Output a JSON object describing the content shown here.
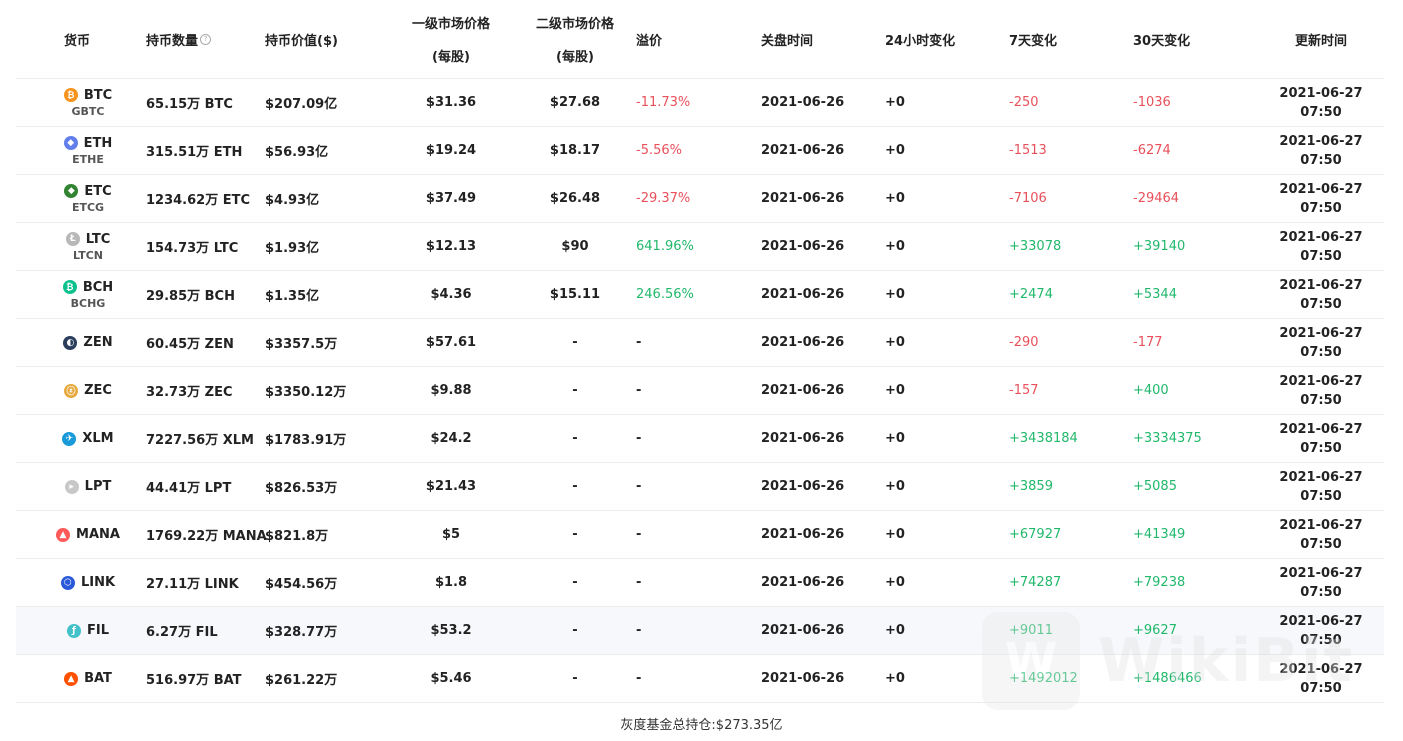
{
  "headers": {
    "coin": "货币",
    "holdings": "持币数量",
    "value": "持币价值($)",
    "primary_line1": "一级市场价格",
    "primary_line2": "(每股)",
    "secondary_line1": "二级市场价格",
    "secondary_line2": "(每股)",
    "premium": "溢价",
    "close_time": "关盘时间",
    "change_24h": "24小时变化",
    "change_7d": "7天变化",
    "change_30d": "30天变化",
    "update_time": "更新时间"
  },
  "rows": [
    {
      "symbol": "BTC",
      "sub": "GBTC",
      "icon_name": "bitcoin-icon",
      "icon_glyph": "₿",
      "icon_color": "#f7931a",
      "holdings": "65.15万 BTC",
      "value": "$207.09亿",
      "primary": "$31.36",
      "secondary": "$27.68",
      "premium": "-11.73%",
      "premium_sign": "neg",
      "close": "2021-06-26",
      "c24": "+0",
      "c7": "-250",
      "c7_sign": "neg",
      "c30": "-1036",
      "c30_sign": "neg",
      "upd_date": "2021-06-27",
      "upd_time": "07:50"
    },
    {
      "symbol": "ETH",
      "sub": "ETHE",
      "icon_name": "ethereum-icon",
      "icon_glyph": "◆",
      "icon_color": "#627eea",
      "holdings": "315.51万 ETH",
      "value": "$56.93亿",
      "primary": "$19.24",
      "secondary": "$18.17",
      "premium": "-5.56%",
      "premium_sign": "neg",
      "close": "2021-06-26",
      "c24": "+0",
      "c7": "-1513",
      "c7_sign": "neg",
      "c30": "-6274",
      "c30_sign": "neg",
      "upd_date": "2021-06-27",
      "upd_time": "07:50"
    },
    {
      "symbol": "ETC",
      "sub": "ETCG",
      "icon_name": "ethereum-classic-icon",
      "icon_glyph": "◆",
      "icon_color": "#328332",
      "holdings": "1234.62万 ETC",
      "value": "$4.93亿",
      "primary": "$37.49",
      "secondary": "$26.48",
      "premium": "-29.37%",
      "premium_sign": "neg",
      "close": "2021-06-26",
      "c24": "+0",
      "c7": "-7106",
      "c7_sign": "neg",
      "c30": "-29464",
      "c30_sign": "neg",
      "upd_date": "2021-06-27",
      "upd_time": "07:50"
    },
    {
      "symbol": "LTC",
      "sub": "LTCN",
      "icon_name": "litecoin-icon",
      "icon_glyph": "Ł",
      "icon_color": "#b8b8b8",
      "holdings": "154.73万 LTC",
      "value": "$1.93亿",
      "primary": "$12.13",
      "secondary": "$90",
      "premium": "641.96%",
      "premium_sign": "pos",
      "close": "2021-06-26",
      "c24": "+0",
      "c7": "+33078",
      "c7_sign": "pos",
      "c30": "+39140",
      "c30_sign": "pos",
      "upd_date": "2021-06-27",
      "upd_time": "07:50"
    },
    {
      "symbol": "BCH",
      "sub": "BCHG",
      "icon_name": "bitcoin-cash-icon",
      "icon_glyph": "₿",
      "icon_color": "#0ac18e",
      "holdings": "29.85万 BCH",
      "value": "$1.35亿",
      "primary": "$4.36",
      "secondary": "$15.11",
      "premium": "246.56%",
      "premium_sign": "pos",
      "close": "2021-06-26",
      "c24": "+0",
      "c7": "+2474",
      "c7_sign": "pos",
      "c30": "+5344",
      "c30_sign": "pos",
      "upd_date": "2021-06-27",
      "upd_time": "07:50"
    },
    {
      "symbol": "ZEN",
      "sub": "",
      "icon_name": "horizen-icon",
      "icon_glyph": "◐",
      "icon_color": "#2b3e5c",
      "holdings": "60.45万 ZEN",
      "value": "$3357.5万",
      "primary": "$57.61",
      "secondary": "-",
      "premium": "-",
      "premium_sign": "none",
      "close": "2021-06-26",
      "c24": "+0",
      "c7": "-290",
      "c7_sign": "neg",
      "c30": "-177",
      "c30_sign": "neg",
      "upd_date": "2021-06-27",
      "upd_time": "07:50"
    },
    {
      "symbol": "ZEC",
      "sub": "",
      "icon_name": "zcash-icon",
      "icon_glyph": "ⓩ",
      "icon_color": "#e5a93d",
      "holdings": "32.73万 ZEC",
      "value": "$3350.12万",
      "primary": "$9.88",
      "secondary": "-",
      "premium": "-",
      "premium_sign": "none",
      "close": "2021-06-26",
      "c24": "+0",
      "c7": "-157",
      "c7_sign": "neg",
      "c30": "+400",
      "c30_sign": "pos",
      "upd_date": "2021-06-27",
      "upd_time": "07:50"
    },
    {
      "symbol": "XLM",
      "sub": "",
      "icon_name": "stellar-icon",
      "icon_glyph": "✈",
      "icon_color": "#1a9ad8",
      "holdings": "7227.56万 XLM",
      "value": "$1783.91万",
      "primary": "$24.2",
      "secondary": "-",
      "premium": "-",
      "premium_sign": "none",
      "close": "2021-06-26",
      "c24": "+0",
      "c7": "+3438184",
      "c7_sign": "pos",
      "c30": "+3334375",
      "c30_sign": "pos",
      "upd_date": "2021-06-27",
      "upd_time": "07:50"
    },
    {
      "symbol": "LPT",
      "sub": "",
      "icon_name": "livepeer-icon",
      "icon_glyph": "▸",
      "icon_color": "#c8c8c8",
      "holdings": "44.41万 LPT",
      "value": "$826.53万",
      "primary": "$21.43",
      "secondary": "-",
      "premium": "-",
      "premium_sign": "none",
      "close": "2021-06-26",
      "c24": "+0",
      "c7": "+3859",
      "c7_sign": "pos",
      "c30": "+5085",
      "c30_sign": "pos",
      "upd_date": "2021-06-27",
      "upd_time": "07:50"
    },
    {
      "symbol": "MANA",
      "sub": "",
      "icon_name": "decentraland-icon",
      "icon_glyph": "▲",
      "icon_color": "#ff5a5a",
      "holdings": "1769.22万 MANA",
      "value": "$821.8万",
      "primary": "$5",
      "secondary": "-",
      "premium": "-",
      "premium_sign": "none",
      "close": "2021-06-26",
      "c24": "+0",
      "c7": "+67927",
      "c7_sign": "pos",
      "c30": "+41349",
      "c30_sign": "pos",
      "upd_date": "2021-06-27",
      "upd_time": "07:50"
    },
    {
      "symbol": "LINK",
      "sub": "",
      "icon_name": "chainlink-icon",
      "icon_glyph": "⬡",
      "icon_color": "#2a5ada",
      "holdings": "27.11万 LINK",
      "value": "$454.56万",
      "primary": "$1.8",
      "secondary": "-",
      "premium": "-",
      "premium_sign": "none",
      "close": "2021-06-26",
      "c24": "+0",
      "c7": "+74287",
      "c7_sign": "pos",
      "c30": "+79238",
      "c30_sign": "pos",
      "upd_date": "2021-06-27",
      "upd_time": "07:50"
    },
    {
      "symbol": "FIL",
      "sub": "",
      "icon_name": "filecoin-icon",
      "icon_glyph": "ƒ",
      "icon_color": "#42c1ca",
      "holdings": "6.27万 FIL",
      "value": "$328.77万",
      "primary": "$53.2",
      "secondary": "-",
      "premium": "-",
      "premium_sign": "none",
      "close": "2021-06-26",
      "c24": "+0",
      "c7": "+9011",
      "c7_sign": "pos",
      "c30": "+9627",
      "c30_sign": "pos",
      "upd_date": "2021-06-27",
      "upd_time": "07:50"
    },
    {
      "symbol": "BAT",
      "sub": "",
      "icon_name": "basic-attention-token-icon",
      "icon_glyph": "▲",
      "icon_color": "#ff5000",
      "holdings": "516.97万 BAT",
      "value": "$261.22万",
      "primary": "$5.46",
      "secondary": "-",
      "premium": "-",
      "premium_sign": "none",
      "close": "2021-06-26",
      "c24": "+0",
      "c7": "+1492012",
      "c7_sign": "pos",
      "c30": "+1486466",
      "c30_sign": "pos",
      "upd_date": "2021-06-27",
      "upd_time": "07:50"
    }
  ],
  "highlighted_row": 11,
  "footer": "灰度基金总持仓:$273.35亿",
  "watermark": "WikiBit",
  "colors": {
    "negative": "#e8505b",
    "positive": "#21b86b"
  }
}
